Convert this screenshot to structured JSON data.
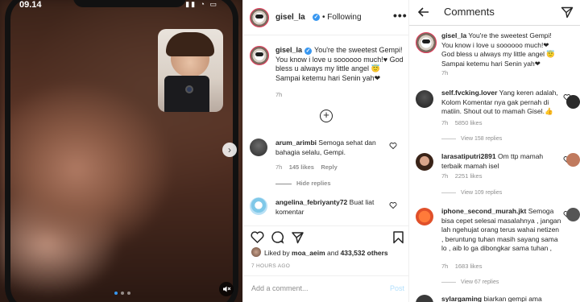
{
  "status_bar": {
    "time": "09.14"
  },
  "post": {
    "username": "gisel_la",
    "follow_state": "Following",
    "more": "•••",
    "caption_username": "gisel_la",
    "caption_text": "You're the sweetest Gempi! You know i love u soooooo much!♥ God bless u always my little angel 😇 Sampai ketemu hari Senin yah❤",
    "caption_age": "7h",
    "comments": [
      {
        "username": "arum_arimbi",
        "text": "Semoga sehat dan bahagia selalu, Gempi.",
        "age": "7h",
        "likes": "145 likes",
        "reply": "Reply",
        "hide_replies": "Hide replies"
      },
      {
        "username": "angelina_febriyanty72",
        "text": "Buat liat komentar"
      }
    ],
    "liked_by_prefix": "Liked by",
    "liked_by_user": "moa_aeim",
    "liked_by_and": "and",
    "liked_by_count": "433,532 others",
    "time_ago": "7 HOURS AGO",
    "add_comment_placeholder": "Add a comment...",
    "post_button": "Post"
  },
  "comments_panel": {
    "title": "Comments",
    "caption_username": "gisel_la",
    "caption_text": "You're the sweetest Gempi! You know i love u soooooo much!❤ God bless u always my little angel 😇 Sampai ketemu hari Senin yah❤",
    "caption_age": "7h",
    "items": [
      {
        "username": "self.fvcking.lover",
        "text": "Yang keren adalah, Kolom Komentar nya gak pernah di matiin. Shout out to mamah Gisel.👍",
        "age": "7h",
        "likes": "5850 likes",
        "view_replies": "View 158 replies"
      },
      {
        "username": "larasatiputri2891",
        "text": "Om ttp mamah terbaik mamah isel",
        "age": "7h",
        "likes": "2251 likes",
        "view_replies": "View 109 replies"
      },
      {
        "username": "iphone_second_murah.jkt",
        "text": "Semoga bisa cepet selesai masalahnya , jangan lah ngehujat orang terus wahai netizen , beruntung tuhan masih sayang sama lo , aib lo ga dibongkar sama tuhan ,",
        "age": "7h",
        "likes": "1683 likes",
        "view_replies": "View 67 replies"
      },
      {
        "username": "sylargaming",
        "text": "biarkan gempi ama"
      }
    ]
  },
  "colors": {
    "link_blue": "#3897f0",
    "heart_red": "#ed4956",
    "muted": "#8e8e8e"
  }
}
